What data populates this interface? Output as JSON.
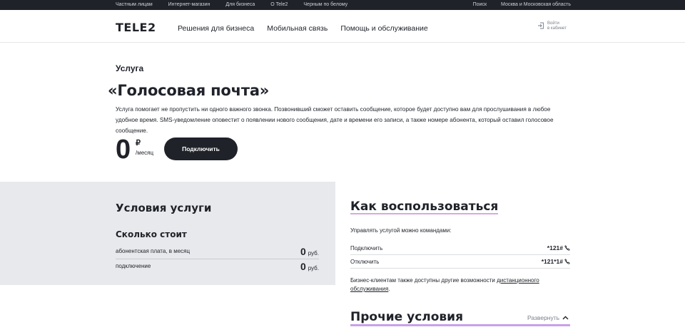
{
  "topbar": {
    "nav": [
      "Частным лицам",
      "Интернет-магазин",
      "Для бизнеса",
      "О Tele2",
      "Черным по белому"
    ],
    "search": "Поиск",
    "region": "Москва и Московская область"
  },
  "header": {
    "logo": "TELE2",
    "nav": [
      "Решения для бизнеса",
      "Мобильная связь",
      "Помощь и обслуживание"
    ],
    "login_line1": "Войти",
    "login_line2": "в кабинет"
  },
  "service": {
    "kicker": "Услуга",
    "title": "«Голосовая почта»",
    "description": "Услуга помогает не пропустить ни одного важного звонка. Позвонивший сможет оставить сообщение, которое будет доступно вам для прослушивания в любое удобное время. SMS-уведомление оповестит о появлении нового сообщения, дате и времени его записи, а также номере абонента, который оставил голосовое сообщение.",
    "price": "0",
    "currency": "₽",
    "period": "/месяц",
    "connect_label": "Подключить"
  },
  "conditions": {
    "title": "Условия услуги",
    "cost_title": "Сколько стоит",
    "rows": [
      {
        "label": "абонентская плата, в месяц",
        "value": "0",
        "unit": "руб."
      },
      {
        "label": "подключение",
        "value": "0",
        "unit": "руб."
      }
    ]
  },
  "howto": {
    "title": "Как воспользоваться",
    "manage_text": "Управлять услугой можно командами:",
    "commands": [
      {
        "label": "Подключить",
        "code": "*121#"
      },
      {
        "label": "Отключить",
        "code": "*121*1#"
      }
    ],
    "note_prefix": "Бизнес-клиентам также доступны другие возможности ",
    "note_link": "дистанционного обслуживания",
    "note_suffix": "."
  },
  "other": {
    "title": "Прочие условия",
    "expand_label": "Развернуть"
  },
  "colors": {
    "dark": "#1f2229",
    "gray_panel": "#e8e9ec",
    "accent_underline": "#c9a0e8"
  },
  "icons": [
    "login-icon",
    "phone-icon",
    "chevron-up-icon"
  ]
}
